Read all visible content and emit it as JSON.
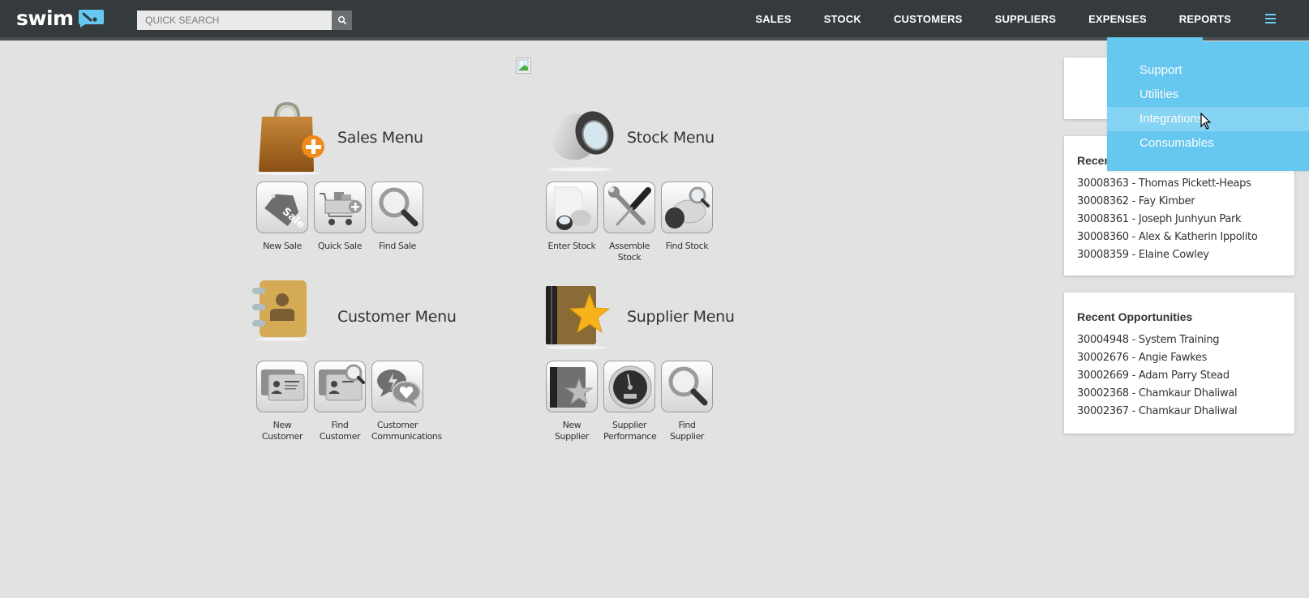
{
  "header": {
    "logo_text": "swim",
    "search": {
      "placeholder": "QUICK SEARCH",
      "value": ""
    },
    "nav": [
      "SALES",
      "STOCK",
      "CUSTOMERS",
      "SUPPLIERS",
      "EXPENSES",
      "REPORTS"
    ],
    "menu_icon": "hamburger-icon"
  },
  "dropdown": {
    "items": [
      "Support",
      "Utilities",
      "Integrations",
      "Consumables"
    ],
    "hovered": "Integrations"
  },
  "colors": {
    "topbar": "#353a3c",
    "accent": "#66c8f0",
    "accent_hover": "#86d4f3",
    "background": "#e2e2e2"
  },
  "sections": {
    "sales": {
      "title": "Sales Menu",
      "icon": "shopping-bag-plus-icon",
      "tiles": [
        {
          "label": "New Sale",
          "icon": "sale-tag-icon"
        },
        {
          "label": "Quick Sale",
          "icon": "shopping-cart-plus-icon"
        },
        {
          "label": "Find Sale",
          "icon": "magnifier-icon"
        }
      ]
    },
    "stock": {
      "title": "Stock Menu",
      "icon": "stock-loupe-icon",
      "tiles": [
        {
          "label": "Enter Stock",
          "icon": "document-stock-icon"
        },
        {
          "label": "Assemble Stock",
          "icon": "wrench-screwdriver-icon"
        },
        {
          "label": "Find Stock",
          "icon": "stock-search-icon"
        }
      ]
    },
    "customer": {
      "title": "Customer Menu",
      "icon": "address-book-icon",
      "tiles": [
        {
          "label": "New Customer",
          "icon": "contact-cards-icon"
        },
        {
          "label": "Find Customer",
          "icon": "contact-cards-search-icon"
        },
        {
          "label": "Customer Communications",
          "icon": "chat-bubbles-icon"
        }
      ]
    },
    "supplier": {
      "title": "Supplier Menu",
      "icon": "star-book-icon",
      "tiles": [
        {
          "label": "New Supplier",
          "icon": "grey-star-book-icon"
        },
        {
          "label": "Supplier Performance",
          "icon": "speedometer-icon"
        },
        {
          "label": "Find Supplier",
          "icon": "magnifier-icon"
        }
      ]
    }
  },
  "right_panel": {
    "recent_customers": {
      "title": "Recent Customers",
      "items": [
        "30008363 - Thomas Pickett-Heaps",
        "30008362 - Fay Kimber",
        "30008361 - Joseph Junhyun Park",
        "30008360 - Alex & Katherin Ippolito",
        "30008359 - Elaine Cowley"
      ]
    },
    "recent_opportunities": {
      "title": "Recent Opportunities",
      "items": [
        "30004948 - System Training",
        "30002676 - Angie Fawkes",
        "30002669 - Adam Parry Stead",
        "30002368 - Chamkaur Dhaliwal",
        "30002367 - Chamkaur Dhaliwal"
      ]
    }
  }
}
